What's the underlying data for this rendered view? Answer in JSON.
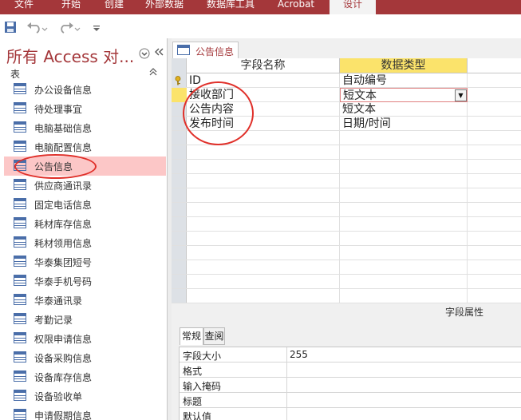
{
  "ribbon": {
    "tabs": [
      "文件",
      "开始",
      "创建",
      "外部数据",
      "数据库工具",
      "Acrobat",
      "设计"
    ],
    "active_tab": "设计"
  },
  "nav": {
    "title": "所有 Access 对...",
    "group": "表",
    "items": [
      {
        "label": "办公设备信息"
      },
      {
        "label": "待处理事宜"
      },
      {
        "label": "电脑基础信息"
      },
      {
        "label": "电脑配置信息"
      },
      {
        "label": "公告信息",
        "selected": true
      },
      {
        "label": "供应商通讯录"
      },
      {
        "label": "固定电话信息"
      },
      {
        "label": "耗材库存信息"
      },
      {
        "label": "耗材领用信息"
      },
      {
        "label": "华泰集团短号"
      },
      {
        "label": "华泰手机号码"
      },
      {
        "label": "华泰通讯录"
      },
      {
        "label": "考勤记录"
      },
      {
        "label": "权限申请信息"
      },
      {
        "label": "设备采购信息"
      },
      {
        "label": "设备库存信息"
      },
      {
        "label": "设备验收单"
      },
      {
        "label": "申请假期信息"
      }
    ]
  },
  "document": {
    "tab_label": "公告信息",
    "columns": {
      "field_name": "字段名称",
      "data_type": "数据类型"
    },
    "fields": [
      {
        "name": "ID",
        "type": "自动编号",
        "primary_key": true
      },
      {
        "name": "接收部门",
        "type": "短文本",
        "current": true
      },
      {
        "name": "公告内容",
        "type": "短文本"
      },
      {
        "name": "发布时间",
        "type": "日期/时间"
      }
    ],
    "field_properties_label": "字段属性",
    "prop_tabs": {
      "general": "常规",
      "lookup": "查阅"
    },
    "properties": [
      {
        "label": "字段大小",
        "value": "255"
      },
      {
        "label": "格式",
        "value": ""
      },
      {
        "label": "输入掩码",
        "value": ""
      },
      {
        "label": "标题",
        "value": ""
      },
      {
        "label": "默认值",
        "value": ""
      }
    ]
  },
  "colors": {
    "access_red": "#a4373a",
    "selected_item": "#fcc7c7",
    "active_header": "#fbe36b",
    "annotation_circle": "#e0302a"
  }
}
